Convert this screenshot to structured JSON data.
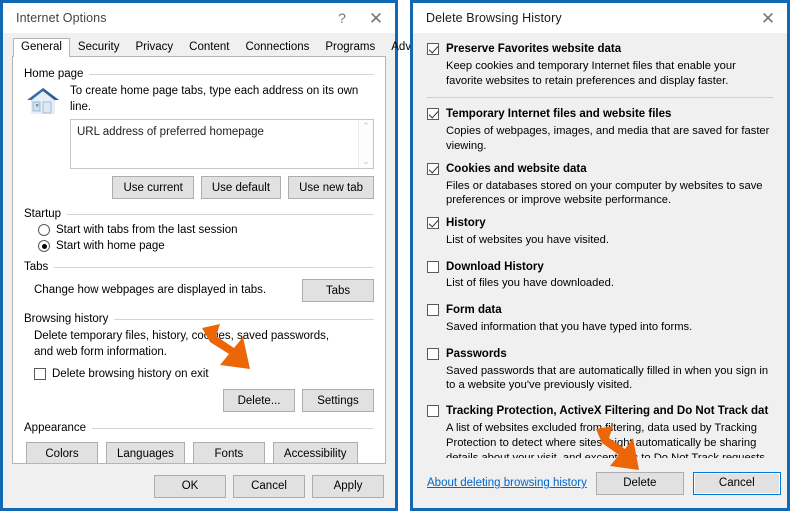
{
  "internet_options": {
    "title": "Internet Options",
    "help_icon": "?",
    "close_icon": "✕",
    "tabs": [
      {
        "label": "General",
        "active": true
      },
      {
        "label": "Security",
        "active": false
      },
      {
        "label": "Privacy",
        "active": false
      },
      {
        "label": "Content",
        "active": false
      },
      {
        "label": "Connections",
        "active": false
      },
      {
        "label": "Programs",
        "active": false
      },
      {
        "label": "Advanced",
        "active": false
      }
    ],
    "home_page": {
      "group_label": "Home page",
      "hint": "To create home page tabs, type each address on its own line.",
      "url_value": "URL address of preferred homepage",
      "scroll_up_icon": "⌃",
      "scroll_down_icon": "⌄",
      "buttons": [
        "Use current",
        "Use default",
        "Use new tab"
      ]
    },
    "startup": {
      "group_label": "Startup",
      "options": [
        {
          "label": "Start with tabs from the last session",
          "selected": false
        },
        {
          "label": "Start with home page",
          "selected": true
        }
      ]
    },
    "tabs_section": {
      "group_label": "Tabs",
      "hint": "Change how webpages are displayed in tabs.",
      "button": "Tabs"
    },
    "browsing_history": {
      "group_label": "Browsing history",
      "hint": "Delete temporary files, history, cookies, saved passwords, and web form information.",
      "checkbox_label": "Delete browsing history on exit",
      "checkbox_checked": false,
      "delete_button": "Delete...",
      "settings_button": "Settings"
    },
    "appearance": {
      "group_label": "Appearance",
      "buttons": [
        "Colors",
        "Languages",
        "Fonts",
        "Accessibility"
      ]
    },
    "footer_buttons": [
      "OK",
      "Cancel",
      "Apply"
    ]
  },
  "delete_history": {
    "title": "Delete Browsing History",
    "close_icon": "✕",
    "items": [
      {
        "label": "Preserve Favorites website data",
        "checked": true,
        "description": "Keep cookies and temporary Internet files that enable your favorite websites to retain preferences and display faster.",
        "separator_after": true
      },
      {
        "label": "Temporary Internet files and website files",
        "checked": true,
        "description": "Copies of webpages, images, and media that are saved for faster viewing.",
        "separator_after": false
      },
      {
        "label": "Cookies and website data",
        "checked": true,
        "description": "Files or databases stored on your computer by websites to save preferences or improve website performance.",
        "separator_after": false
      },
      {
        "label": "History",
        "checked": true,
        "description": "List of websites you have visited.",
        "separator_after": false
      },
      {
        "label": "Download History",
        "checked": false,
        "description": "List of files you have downloaded.",
        "separator_after": false
      },
      {
        "label": "Form data",
        "checked": false,
        "description": "Saved information that you have typed into forms.",
        "separator_after": false
      },
      {
        "label": "Passwords",
        "checked": false,
        "description": "Saved passwords that are automatically filled in when you sign in to a website you've previously visited.",
        "separator_after": false
      },
      {
        "label": "Tracking Protection, ActiveX Filtering and Do Not Track dat",
        "checked": false,
        "description": "A list of websites excluded from filtering, data used by Tracking Protection to detect where sites might automatically be sharing details about your visit, and exceptions to Do Not Track requests.",
        "separator_after": false
      }
    ],
    "about_link": "About deleting browsing history",
    "delete_button": "Delete",
    "cancel_button": "Cancel"
  },
  "annotations": {
    "arrow_color": "#ec6608",
    "arrows": [
      {
        "name": "arrow-pointing-to-delete-button-internet-options"
      },
      {
        "name": "arrow-pointing-to-delete-button-delete-history"
      }
    ]
  }
}
